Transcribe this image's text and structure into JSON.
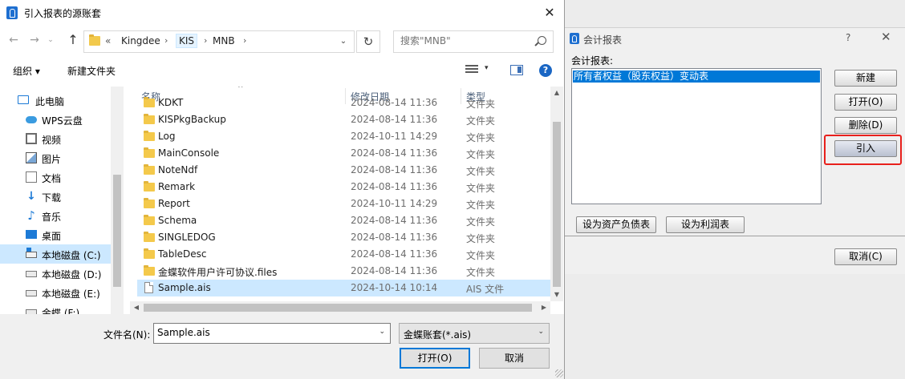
{
  "file_dialog": {
    "title": "引入报表的源账套",
    "close_glyph": "✕",
    "nav": {
      "back": "←",
      "forward": "→",
      "recent": "⌄",
      "up": "↑",
      "refresh": "↻"
    },
    "breadcrumb": {
      "overflow": "«",
      "items": [
        "Kingdee",
        "KIS",
        "MNB"
      ],
      "separator": "›",
      "dropdown": "⌄"
    },
    "search": {
      "placeholder": "搜索\"MNB\""
    },
    "toolbar": {
      "organize": "组织 ▾",
      "new_folder": "新建文件夹",
      "view_chevron": "▾",
      "help": "?"
    },
    "nav_pane": {
      "items": [
        {
          "label": "此电脑",
          "icon": "computer-icon"
        },
        {
          "label": "WPS云盘",
          "icon": "cloud-icon"
        },
        {
          "label": "视频",
          "icon": "video-icon"
        },
        {
          "label": "图片",
          "icon": "picture-icon"
        },
        {
          "label": "文档",
          "icon": "document-icon"
        },
        {
          "label": "下载",
          "icon": "download-icon"
        },
        {
          "label": "音乐",
          "icon": "music-icon"
        },
        {
          "label": "桌面",
          "icon": "desktop-icon"
        },
        {
          "label": "本地磁盘 (C:)",
          "icon": "drive-icon"
        },
        {
          "label": "本地磁盘 (D:)",
          "icon": "drive-icon"
        },
        {
          "label": "本地磁盘 (E:)",
          "icon": "drive-icon"
        },
        {
          "label": "金蝶 (F:)",
          "icon": "drive-icon"
        }
      ],
      "selected_index": 8
    },
    "columns": {
      "name": "名称",
      "date": "修改日期",
      "type": "类型",
      "sort_caret": "^"
    },
    "files": [
      {
        "name": "KDKT",
        "date": "2024-08-14 11:36",
        "type": "文件夹",
        "kind": "folder"
      },
      {
        "name": "KISPkgBackup",
        "date": "2024-08-14 11:36",
        "type": "文件夹",
        "kind": "folder"
      },
      {
        "name": "Log",
        "date": "2024-10-11 14:29",
        "type": "文件夹",
        "kind": "folder"
      },
      {
        "name": "MainConsole",
        "date": "2024-08-14 11:36",
        "type": "文件夹",
        "kind": "folder"
      },
      {
        "name": "NoteNdf",
        "date": "2024-08-14 11:36",
        "type": "文件夹",
        "kind": "folder"
      },
      {
        "name": "Remark",
        "date": "2024-08-14 11:36",
        "type": "文件夹",
        "kind": "folder"
      },
      {
        "name": "Report",
        "date": "2024-10-11 14:29",
        "type": "文件夹",
        "kind": "folder"
      },
      {
        "name": "Schema",
        "date": "2024-08-14 11:36",
        "type": "文件夹",
        "kind": "folder"
      },
      {
        "name": "SINGLEDOG",
        "date": "2024-08-14 11:36",
        "type": "文件夹",
        "kind": "folder"
      },
      {
        "name": "TableDesc",
        "date": "2024-08-14 11:36",
        "type": "文件夹",
        "kind": "folder"
      },
      {
        "name": "金蝶软件用户许可协议.files",
        "date": "2024-08-14 11:36",
        "type": "文件夹",
        "kind": "folder"
      },
      {
        "name": "Sample.ais",
        "date": "2024-10-14 10:14",
        "type": "AIS 文件",
        "kind": "file"
      }
    ],
    "selected_file_index": 11,
    "scroll_glyphs": {
      "up": "▲",
      "down": "▼",
      "left": "◀",
      "right": "▶"
    },
    "bottom": {
      "filename_label": "文件名(N):",
      "filename_value": "Sample.ais",
      "filetype_value": "金蝶账套(*.ais)",
      "chevron": "⌄",
      "open_label": "打开(O)",
      "cancel_label": "取消"
    }
  },
  "report_window": {
    "title": "会计报表",
    "help": "?",
    "close_glyph": "✕",
    "list_label": "会计报表:",
    "list_items": [
      "所有者权益（股东权益）变动表"
    ],
    "buttons": {
      "new": "新建",
      "open": "打开(O)",
      "delete": "删除(D)",
      "import": "引入",
      "set_balance": "设为资产负债表",
      "set_income": "设为利润表",
      "cancel": "取消(C)"
    },
    "highlight_color": "#e8201c"
  }
}
